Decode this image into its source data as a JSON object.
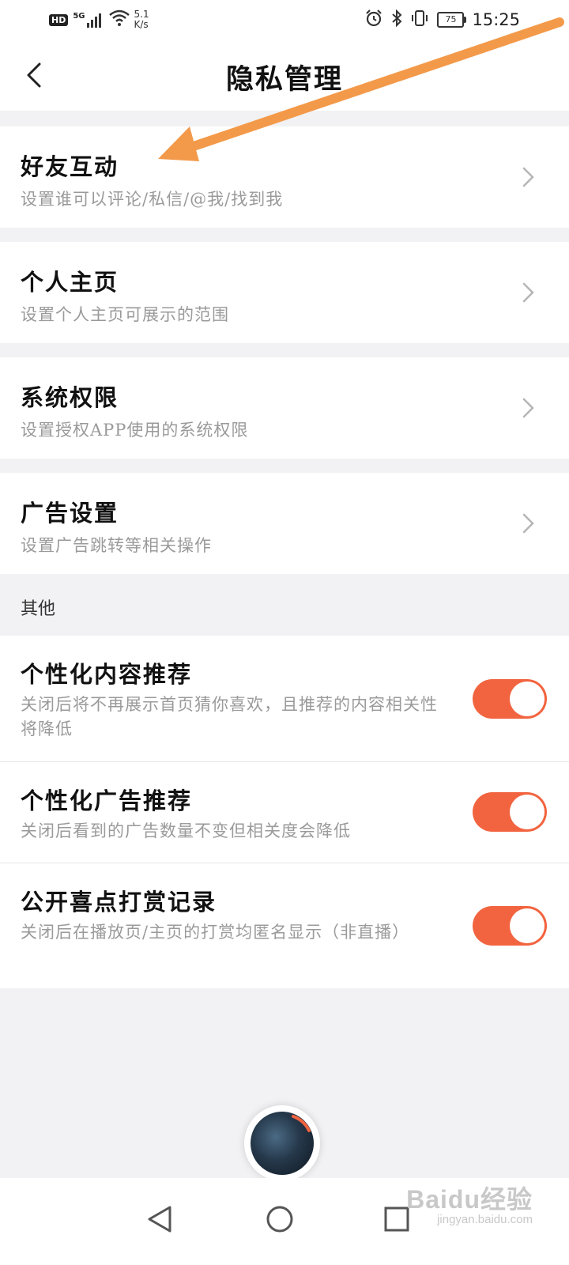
{
  "status_bar": {
    "hd": "HD",
    "network": "5G",
    "speed_value": "5.1",
    "speed_unit": "K/s",
    "battery": "75",
    "time": "15:25"
  },
  "header": {
    "title": "隐私管理"
  },
  "settings": [
    {
      "title": "好友互动",
      "subtitle": "设置谁可以评论/私信/@我/找到我"
    },
    {
      "title": "个人主页",
      "subtitle": "设置个人主页可展示的范围"
    },
    {
      "title": "系统权限",
      "subtitle": "设置授权APP使用的系统权限"
    },
    {
      "title": "广告设置",
      "subtitle": "设置广告跳转等相关操作"
    }
  ],
  "other_section": {
    "label": "其他",
    "toggles": [
      {
        "title": "个性化内容推荐",
        "subtitle": "关闭后将不再展示首页猜你喜欢，且推荐的内容相关性将降低",
        "on": true
      },
      {
        "title": "个性化广告推荐",
        "subtitle": "关闭后看到的广告数量不变但相关度会降低",
        "on": true
      },
      {
        "title": "公开喜点打赏记录",
        "subtitle": "关闭后在播放页/主页的打赏均匿名显示（非直播）",
        "on": true
      }
    ]
  },
  "colors": {
    "accent": "#f2643f",
    "annotation_arrow": "#f39a4a"
  },
  "watermark": {
    "brand": "Baidu经验",
    "site": "jingyan.baidu.com"
  },
  "icons": [
    "back-icon",
    "chevron-right-icon",
    "alarm-icon",
    "bluetooth-icon",
    "vibrate-icon",
    "wifi-icon",
    "signal-icon",
    "battery-icon",
    "nav-back-icon",
    "nav-home-icon",
    "nav-recents-icon"
  ]
}
